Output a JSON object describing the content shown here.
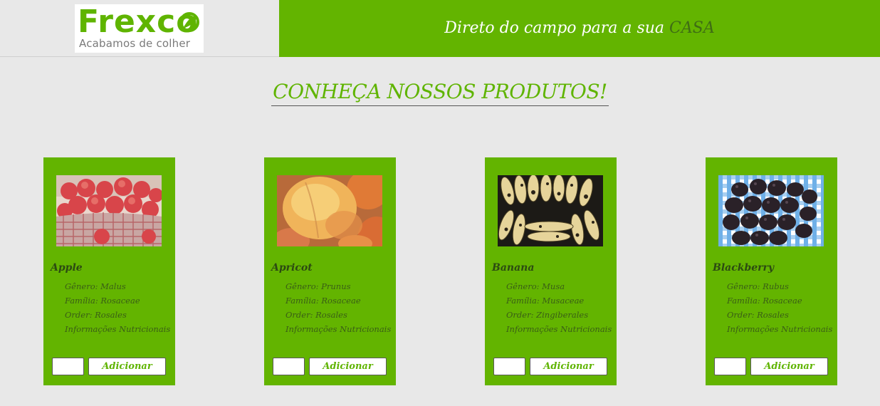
{
  "header": {
    "logo": {
      "brand": "Frexco",
      "slogan": "Acabamos de colher"
    },
    "tagline": {
      "main": "Direto do campo para a sua",
      "accent": "CASA"
    }
  },
  "section": {
    "title": "CONHEÇA NOSSOS PRODUTOS!"
  },
  "colors": {
    "brand_green": "#63b400",
    "dark_green_text": "#2c4a12",
    "background": "#e8e8e8"
  },
  "products": [
    {
      "name": "Apple",
      "genus": "Gênero: Malus",
      "family": "Família: Rosaceae",
      "order": "Order: Rosales",
      "nutrition": "Informações Nutricionais",
      "quantity": "",
      "add_label": "Adicionar",
      "image": "apples-in-basket"
    },
    {
      "name": "Apricot",
      "genus": "Gênero: Prunus",
      "family": "Família: Rosaceae",
      "order": "Order: Rosales",
      "nutrition": "Informações Nutricionais",
      "quantity": "",
      "add_label": "Adicionar",
      "image": "apricots"
    },
    {
      "name": "Banana",
      "genus": "Gênero: Musa",
      "family": "Família: Musaceae",
      "order": "Order: Zingiberales",
      "nutrition": "Informações Nutricionais",
      "quantity": "",
      "add_label": "Adicionar",
      "image": "bananas"
    },
    {
      "name": "Blackberry",
      "genus": "Gênero: Rubus",
      "family": "Família: Rosaceae",
      "order": "Order: Rosales",
      "nutrition": "Informações Nutricionais",
      "quantity": "",
      "add_label": "Adicionar",
      "image": "blackberries"
    }
  ]
}
